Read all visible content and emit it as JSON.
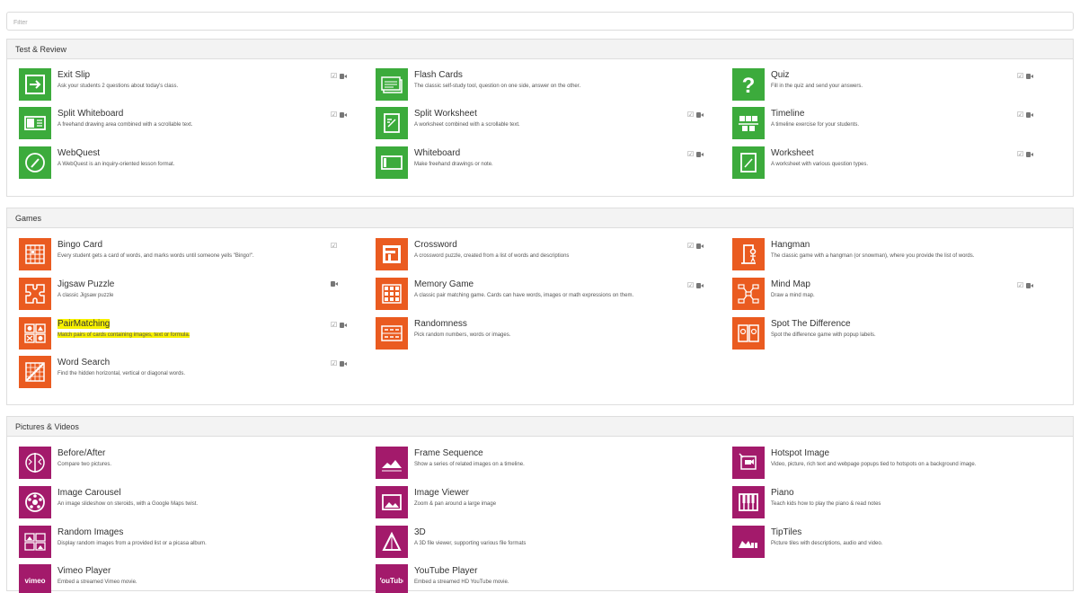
{
  "filter": {
    "placeholder": "Filter"
  },
  "sections": [
    {
      "title": "Test & Review",
      "items": [
        {
          "name": "Exit Slip",
          "desc": "Ask your students 2 questions about today's class.",
          "icon": "exit-icon",
          "check": true,
          "video": true
        },
        {
          "name": "Flash Cards",
          "desc": "The classic self-study tool, question on one side, answer on the other.",
          "icon": "flashcards-icon",
          "check": false,
          "video": false
        },
        {
          "name": "Quiz",
          "desc": "Fill in the quiz and send your answers.",
          "icon": "question-mark-icon",
          "check": true,
          "video": true
        },
        {
          "name": "Split Whiteboard",
          "desc": "A freehand drawing area combined with a scrollable text.",
          "icon": "split-board-icon",
          "check": true,
          "video": true
        },
        {
          "name": "Split Worksheet",
          "desc": "A worksheet combined with a scrollable text.",
          "icon": "split-worksheet-icon",
          "check": true,
          "video": true
        },
        {
          "name": "Timeline",
          "desc": "A timeline exercise for your students.",
          "icon": "timeline-icon",
          "check": true,
          "video": true
        },
        {
          "name": "WebQuest",
          "desc": "A WebQuest is an inquiry-oriented lesson format.",
          "icon": "magnifier-icon",
          "check": false,
          "video": false
        },
        {
          "name": "Whiteboard",
          "desc": "Make freehand drawings or note.",
          "icon": "whiteboard-icon",
          "check": true,
          "video": true
        },
        {
          "name": "Worksheet",
          "desc": "A worksheet with various question types.",
          "icon": "worksheet-icon",
          "check": true,
          "video": true
        }
      ]
    },
    {
      "title": "Games",
      "items": [
        {
          "name": "Bingo Card",
          "desc": "Every student gets a card of words, and marks words until someone yells \"Bingo!\".",
          "icon": "bingo-icon",
          "check": true,
          "video": false
        },
        {
          "name": "Crossword",
          "desc": "A crossword puzzle, created from a list of words and descriptions",
          "icon": "crossword-icon",
          "check": true,
          "video": true
        },
        {
          "name": "Hangman",
          "desc": "The classic game with a hangman (or snowman), where you provide the list of words.",
          "icon": "hangman-icon",
          "check": false,
          "video": false
        },
        {
          "name": "Jigsaw Puzzle",
          "desc": "A classic Jigsaw puzzle",
          "icon": "puzzle-icon",
          "check": false,
          "video": true
        },
        {
          "name": "Memory Game",
          "desc": "A classic pair matching game. Cards can have words, images or math expressions on them.",
          "icon": "memory-icon",
          "check": true,
          "video": true
        },
        {
          "name": "Mind Map",
          "desc": "Draw a mind map.",
          "icon": "mindmap-icon",
          "check": true,
          "video": true
        },
        {
          "name": "PairMatching",
          "desc": "Match pairs of cards containing images, text or formula.",
          "icon": "pairmatching-icon",
          "check": true,
          "video": true,
          "highlight": true
        },
        {
          "name": "Randomness",
          "desc": "Pick random numbers, words or images.",
          "icon": "random-icon",
          "check": false,
          "video": false
        },
        {
          "name": "Spot The Difference",
          "desc": "Spot the difference game with popup labels.",
          "icon": "spot-difference-icon",
          "check": false,
          "video": false
        },
        {
          "name": "Word Search",
          "desc": "Find the hidden horizontal, vertical or diagonal words.",
          "icon": "wordsearch-icon",
          "check": true,
          "video": true
        }
      ]
    },
    {
      "title": "Pictures & Videos",
      "items": [
        {
          "name": "Before/After",
          "desc": "Compare two pictures.",
          "icon": "before-after-icon",
          "check": false,
          "video": false
        },
        {
          "name": "Frame Sequence",
          "desc": "Show a series of related images on a timeline.",
          "icon": "frame-sequence-icon",
          "check": false,
          "video": false
        },
        {
          "name": "Hotspot Image",
          "desc": "Video, picture, rich text and webpage popups tied to hotspots on a background image.",
          "icon": "hotspot-icon",
          "check": false,
          "video": false
        },
        {
          "name": "Image Carousel",
          "desc": "An image slideshow on steroids, with a Google Maps twist.",
          "icon": "carousel-icon",
          "check": false,
          "video": false
        },
        {
          "name": "Image Viewer",
          "desc": "Zoom & pan around a large image",
          "icon": "image-icon",
          "check": false,
          "video": false
        },
        {
          "name": "Piano",
          "desc": "Teach kids how to play the piano & read notes",
          "icon": "piano-icon",
          "check": false,
          "video": false
        },
        {
          "name": "Random Images",
          "desc": "Display random images from a provided list or a picasa album.",
          "icon": "random-images-icon",
          "check": false,
          "video": false
        },
        {
          "name": "3D",
          "desc": "A 3D file viewer, supporting various file formats",
          "icon": "triangle-icon",
          "check": false,
          "video": false
        },
        {
          "name": "TipTiles",
          "desc": "Picture tiles with descriptions, audio and video.",
          "icon": "tiptiles-icon",
          "check": false,
          "video": false
        },
        {
          "name": "Vimeo Player",
          "desc": "Embed a streamed Vimeo movie.",
          "icon": "vimeo-icon",
          "iconText": "vimeo",
          "check": false,
          "video": false
        },
        {
          "name": "YouTube Player",
          "desc": "Embed a streamed HD YouTube movie.",
          "icon": "youtube-icon",
          "iconText": "YouTube",
          "check": false,
          "video": false
        }
      ]
    }
  ]
}
